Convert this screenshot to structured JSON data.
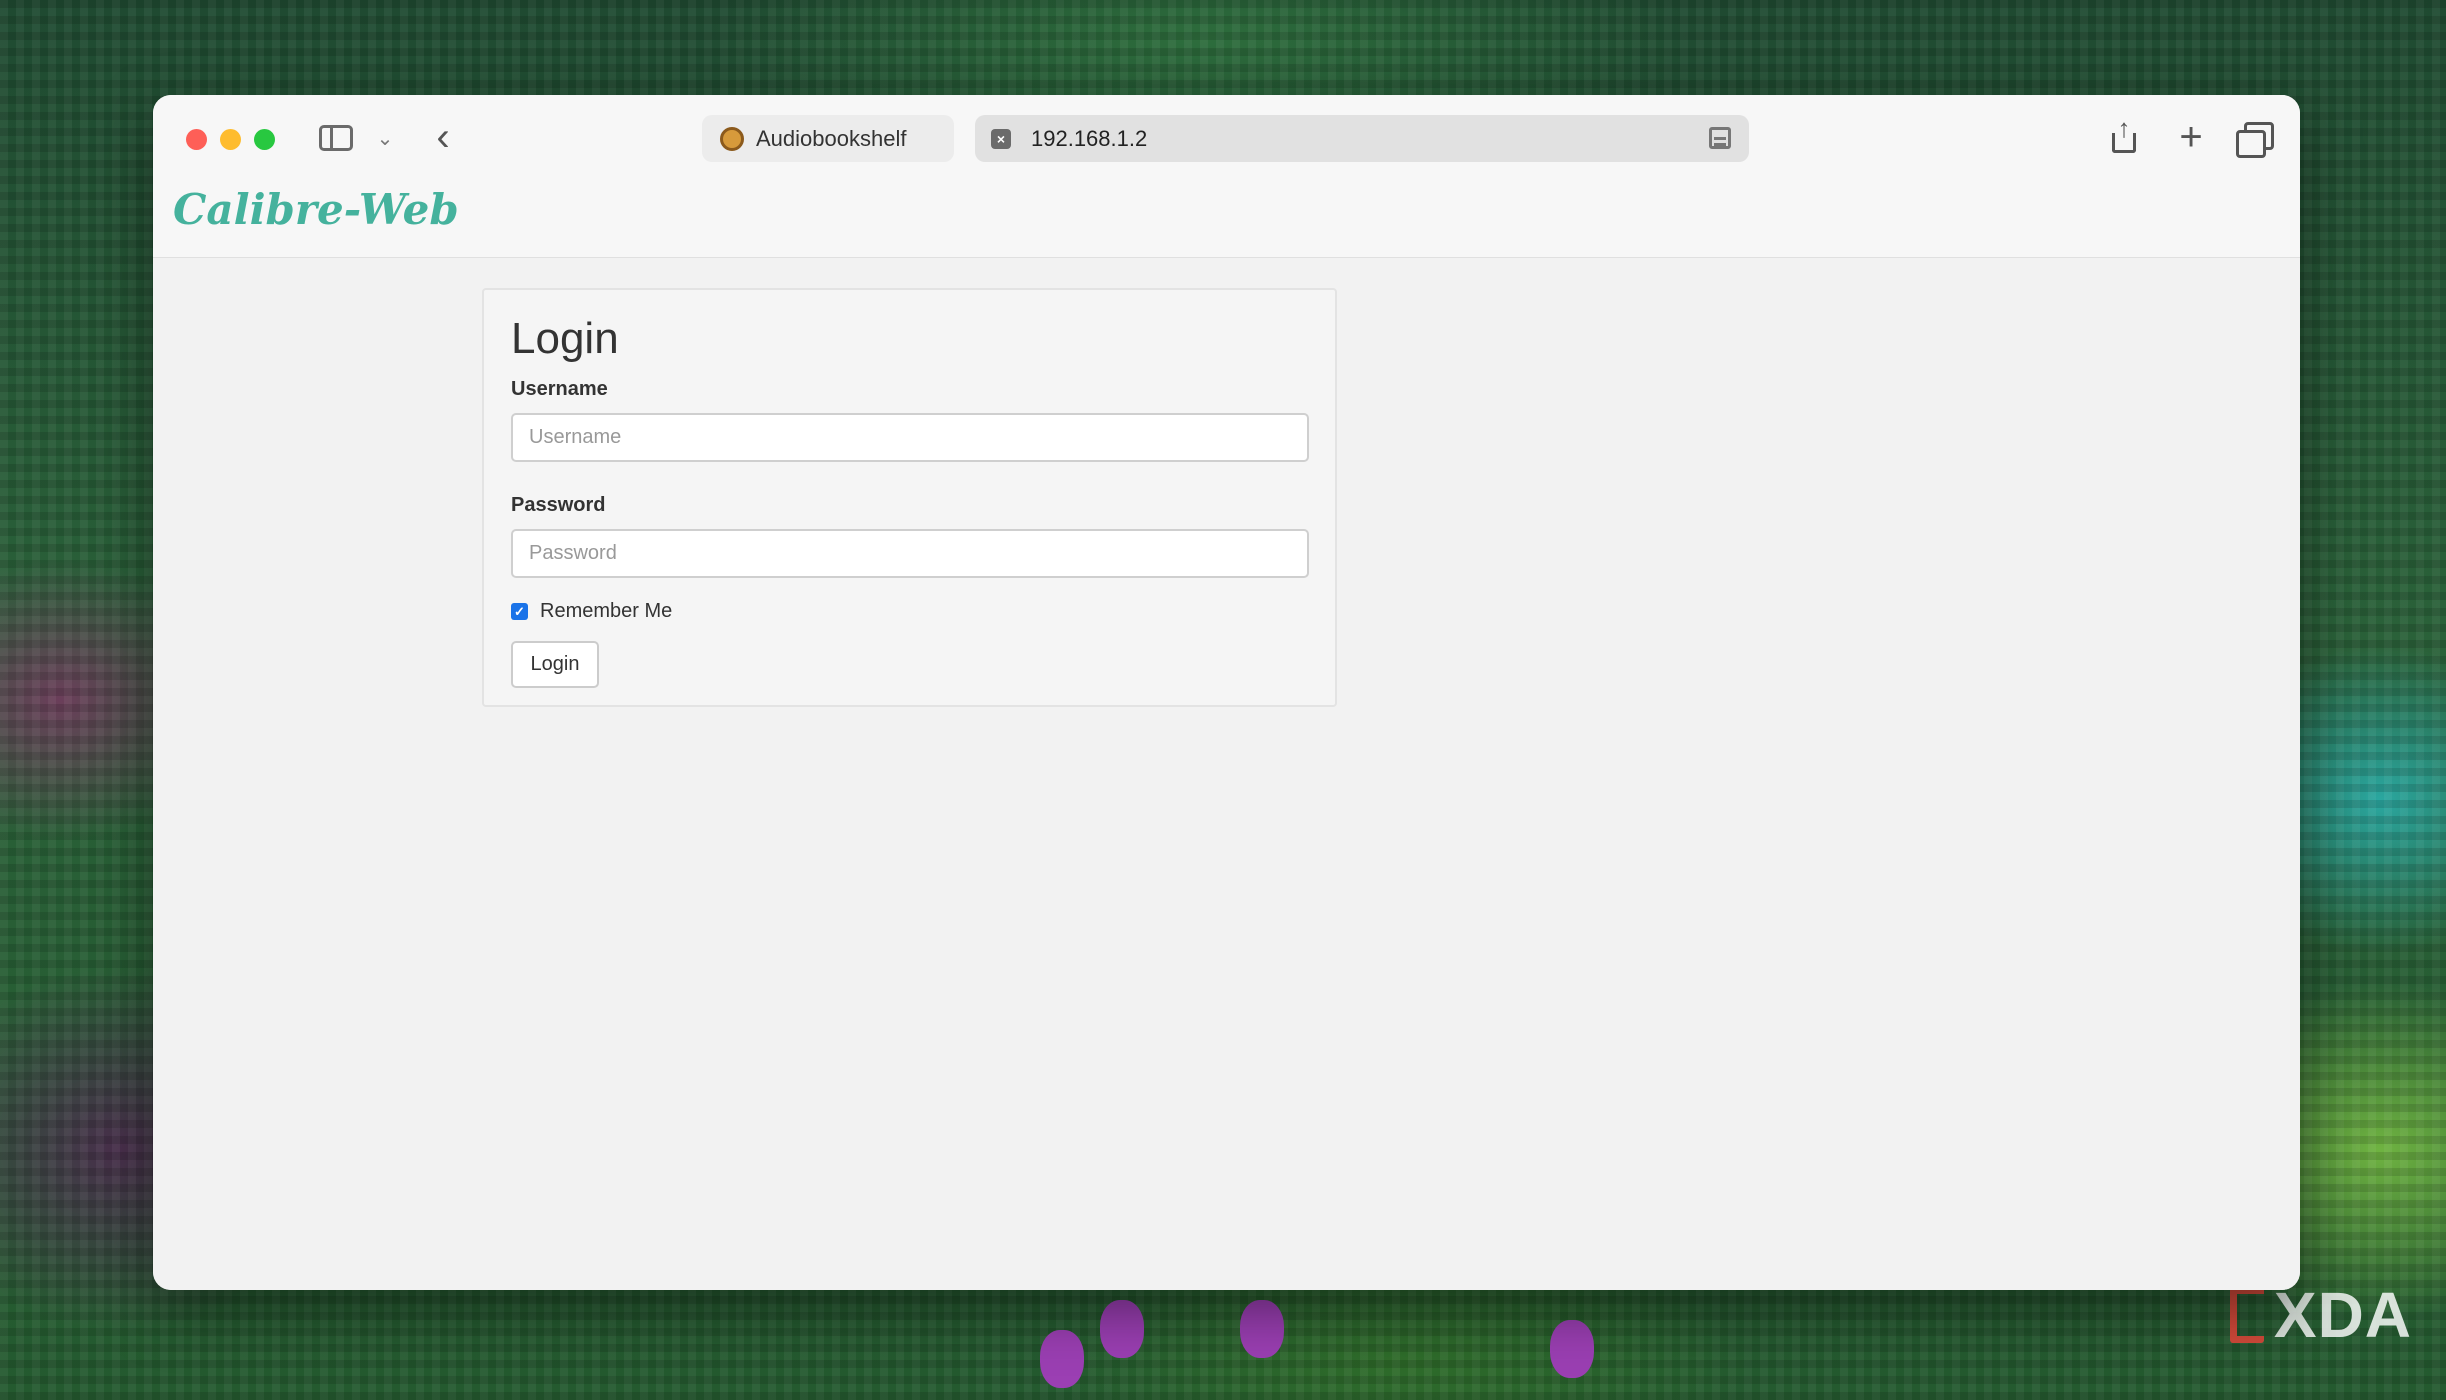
{
  "browser": {
    "tab_label": "Audiobookshelf",
    "address": "192.168.1.2",
    "icons": {
      "sidebar": "sidebar-icon",
      "chevron": "chevron-down-icon",
      "back": "back-arrow-icon",
      "share": "share-icon",
      "new_tab": "plus-icon",
      "tabs": "tab-overview-icon",
      "reader": "reader-mode-icon"
    }
  },
  "app": {
    "brand": "Calibre-Web",
    "brand_color": "#45b29d"
  },
  "login": {
    "title": "Login",
    "username_label": "Username",
    "username_placeholder": "Username",
    "username_value": "",
    "password_label": "Password",
    "password_placeholder": "Password",
    "password_value": "",
    "remember_label": "Remember Me",
    "remember_checked": true,
    "button_label": "Login"
  },
  "watermark": {
    "text": "XDA"
  }
}
